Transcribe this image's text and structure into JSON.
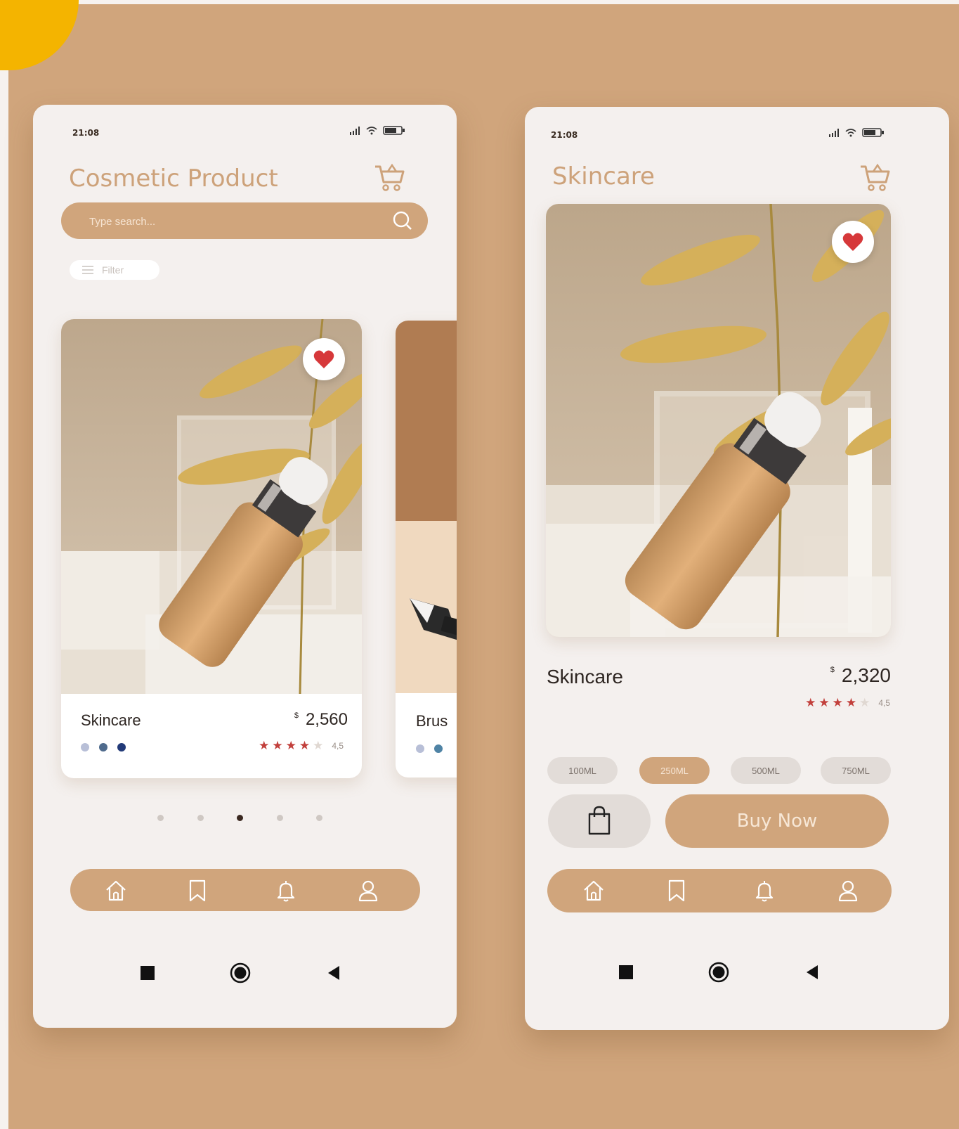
{
  "left_phone": {
    "status_time": "21:08",
    "title": "Cosmetic Product",
    "search_placeholder": "Type search...",
    "filter_label": "Filter",
    "card": {
      "name": "Skincare",
      "currency": "$",
      "price": "2,560",
      "rating": "4,5",
      "stars_filled": 4,
      "colors": [
        "#b8bfd7",
        "#4f6b8d",
        "#223a78"
      ]
    },
    "next_card": {
      "name": "Brus",
      "colors": [
        "#b8bfd7",
        "#4f83a5"
      ]
    },
    "carousel": {
      "count": 5,
      "active_index": 2
    },
    "nav_icons": [
      "home-icon",
      "bookmark-icon",
      "bell-icon",
      "user-icon"
    ]
  },
  "right_phone": {
    "status_time": "21:08",
    "title": "Skincare",
    "product_name": "Skincare",
    "currency": "$",
    "price": "2,320",
    "rating": "4,5",
    "stars_filled": 4,
    "sizes": [
      "100ML",
      "250ML",
      "500ML",
      "750ML"
    ],
    "selected_size": "250ML",
    "buy_label": "Buy Now",
    "nav_icons": [
      "home-icon",
      "bookmark-icon",
      "bell-icon",
      "user-icon"
    ]
  },
  "colors": {
    "background": "#d0a57c",
    "accent": "#d0a57c",
    "title": "#cda27a",
    "star": "#c2403c",
    "heart": "#d6383a"
  }
}
